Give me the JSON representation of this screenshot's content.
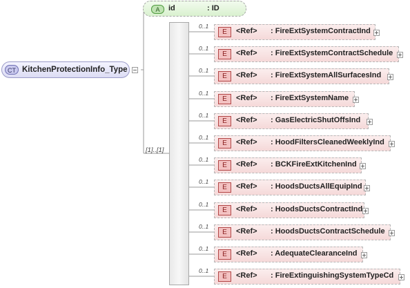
{
  "complex_type": {
    "badge": "CT",
    "name": "KitchenProtectionInfo_Type"
  },
  "attribute": {
    "badge": "A",
    "name": "id",
    "type": ": ID"
  },
  "sequence": {
    "cardinality": "[1]..[1]"
  },
  "element_badge": "E",
  "ref_label": "<Ref>",
  "elements": [
    {
      "cardinality": "0..1",
      "name": ": FireExtSystemContractInd"
    },
    {
      "cardinality": "0..1",
      "name": ": FireExtSystemContractSchedule"
    },
    {
      "cardinality": "0..1",
      "name": ": FireExtSystemAllSurfacesInd"
    },
    {
      "cardinality": "0..1",
      "name": ": FireExtSystemName"
    },
    {
      "cardinality": "0..1",
      "name": ": GasElectricShutOffsInd"
    },
    {
      "cardinality": "0..1",
      "name": ": HoodFiltersCleanedWeeklyInd"
    },
    {
      "cardinality": "0..1",
      "name": ": BCKFireExtKitchenInd"
    },
    {
      "cardinality": "0..1",
      "name": ": HoodsDuctsAllEquipInd"
    },
    {
      "cardinality": "0..1",
      "name": ": HoodsDuctsContractInd"
    },
    {
      "cardinality": "0..1",
      "name": ": HoodsDuctsContractSchedule"
    },
    {
      "cardinality": "0..1",
      "name": ": AdequateClearanceInd"
    },
    {
      "cardinality": "0..1",
      "name": ": FireExtinguishingSystemTypeCd"
    }
  ]
}
